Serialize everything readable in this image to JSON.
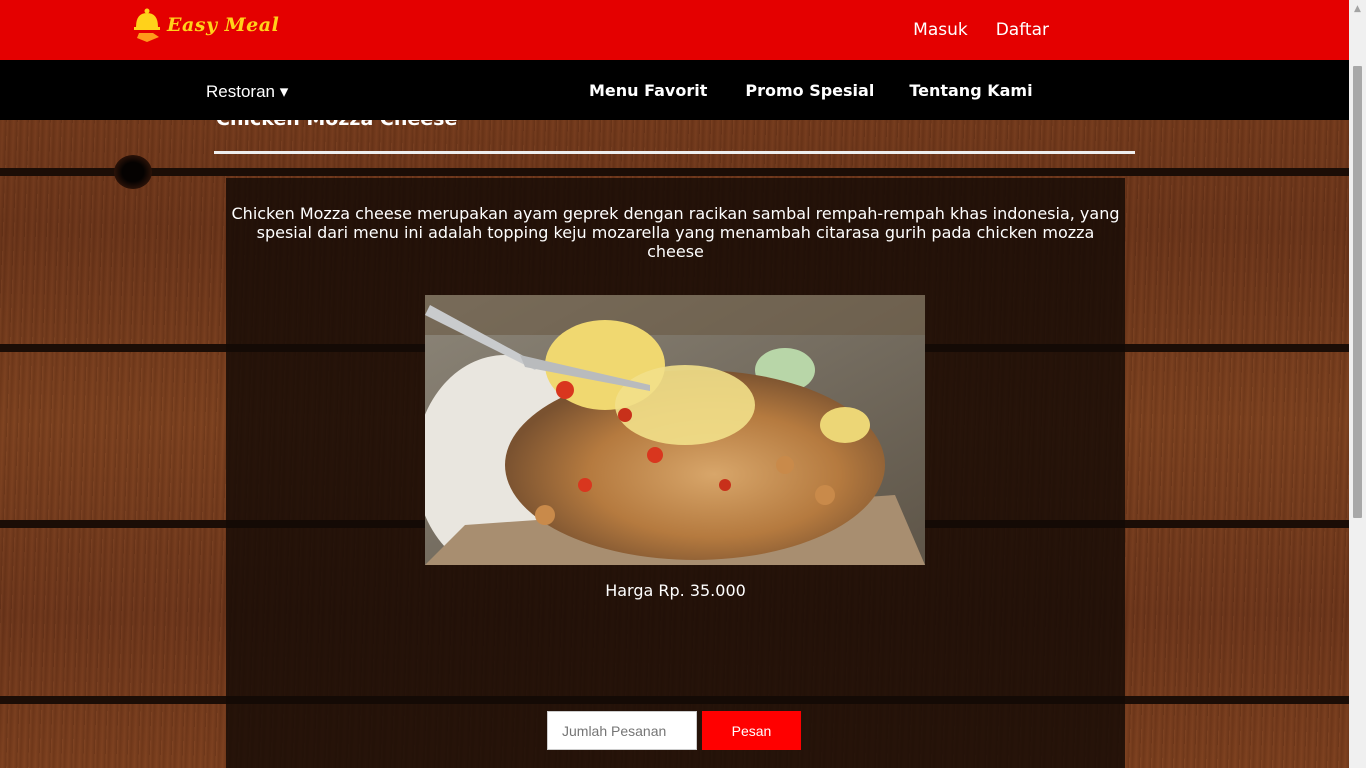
{
  "brand": {
    "name": "Easy Meal",
    "color": "#ffd21a"
  },
  "topnav": {
    "login": "Masuk",
    "register": "Daftar"
  },
  "navbar": {
    "dropdown_label": "Restoran ▾",
    "menu": [
      "Menu Favorit",
      "Promo Spesial",
      "Tentang Kami"
    ]
  },
  "product": {
    "name": "Chicken Mozza Cheese",
    "description": "Chicken Mozza cheese merupakan ayam geprek dengan racikan sambal rempah-rempah khas indonesia, yang spesial dari menu ini adalah topping keju mozarella yang menambah citarasa gurih pada chicken mozza cheese",
    "price": "Harga Rp. 35.000"
  },
  "order_form": {
    "quantity_placeholder": "Jumlah Pesanan",
    "submit_label": "Pesan"
  },
  "colors": {
    "topbar": "#e40000",
    "navbar": "#000000",
    "button": "#ff0000"
  }
}
